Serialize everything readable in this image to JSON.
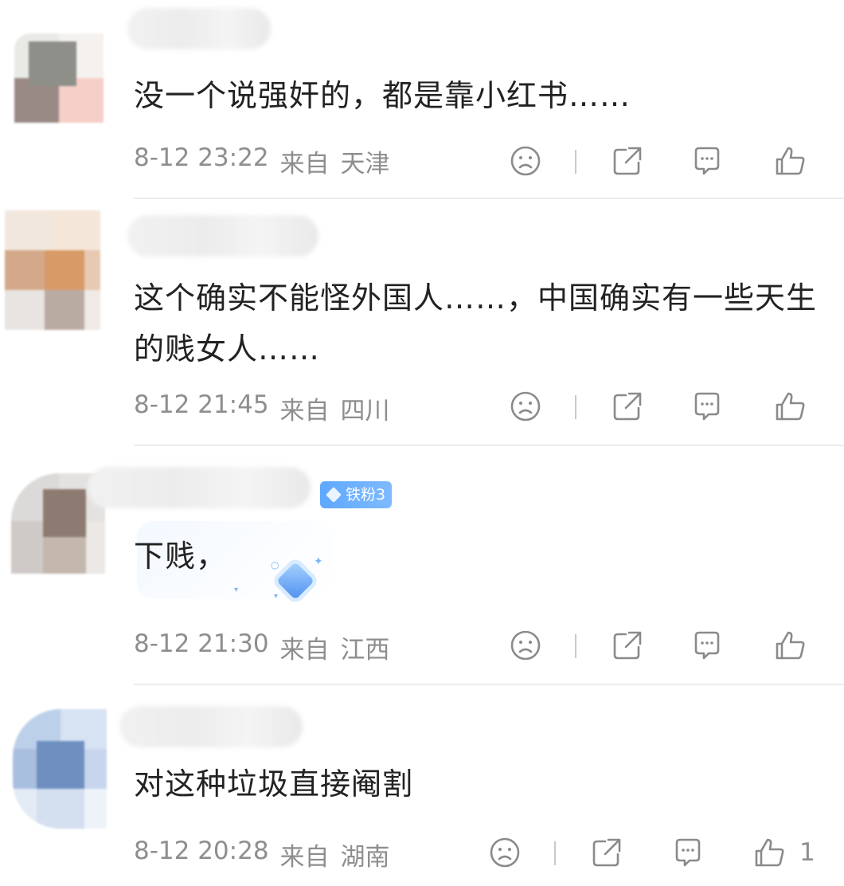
{
  "comments": [
    {
      "text": "没一个说强奸的，都是靠小红书……",
      "time": "8-12 23:22",
      "from": "来自",
      "location": "天津",
      "likes": ""
    },
    {
      "text": "这个确实不能怪外国人……，中国确实有一些天生的贱女人……",
      "time": "8-12 21:45",
      "from": "来自",
      "location": "四川",
      "likes": ""
    },
    {
      "text": "下贱，",
      "badge": "铁粉3",
      "time": "8-12 21:30",
      "from": "来自",
      "location": "江西",
      "likes": ""
    },
    {
      "text": "对这种垃圾直接阉割",
      "time": "8-12 20:28",
      "from": "来自",
      "location": "湖南",
      "likes": "1"
    }
  ],
  "icons": {
    "dislike": "sad-face-icon",
    "share": "share-icon",
    "reply": "comment-icon",
    "like": "thumbs-up-icon"
  },
  "colors": {
    "text": "#222222",
    "meta": "#8e8e8e",
    "badge": "#5fa8ff"
  }
}
